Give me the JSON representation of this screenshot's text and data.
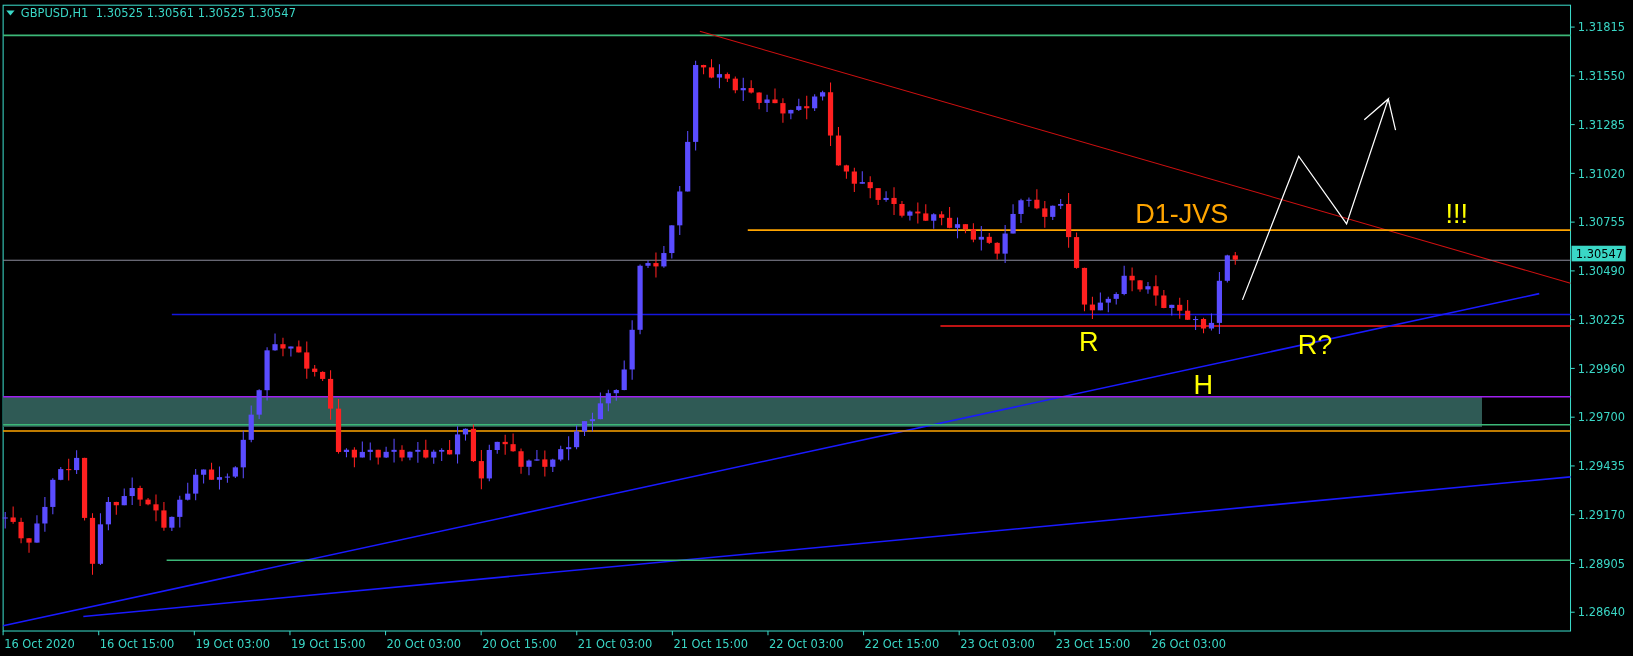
{
  "chart": {
    "symbol": "GBPUSD,H1",
    "quote": "1.30525 1.30561 1.30525 1.30547",
    "current_price": "1.30547",
    "price_axis": [
      "1.31815",
      "1.31550",
      "1.31285",
      "1.31020",
      "1.30755",
      "1.30490",
      "1.30225",
      "1.29960",
      "1.29700",
      "1.29435",
      "1.29170",
      "1.28905",
      "1.28640"
    ],
    "time_axis": [
      "16 Oct 2020",
      "16 Oct 15:00",
      "19 Oct 03:00",
      "19 Oct 15:00",
      "20 Oct 03:00",
      "20 Oct 15:00",
      "21 Oct 03:00",
      "21 Oct 15:00",
      "22 Oct 03:00",
      "22 Oct 15:00",
      "23 Oct 03:00",
      "23 Oct 15:00",
      "26 Oct 03:00"
    ],
    "annotations": [
      {
        "text": "D1-JVS",
        "color": "#ffa500"
      },
      {
        "text": "!!!",
        "color": "#ffff00"
      },
      {
        "text": "R",
        "color": "#ffff00"
      },
      {
        "text": "R?",
        "color": "#ffff00"
      },
      {
        "text": "H",
        "color": "#ffff00"
      }
    ]
  }
}
